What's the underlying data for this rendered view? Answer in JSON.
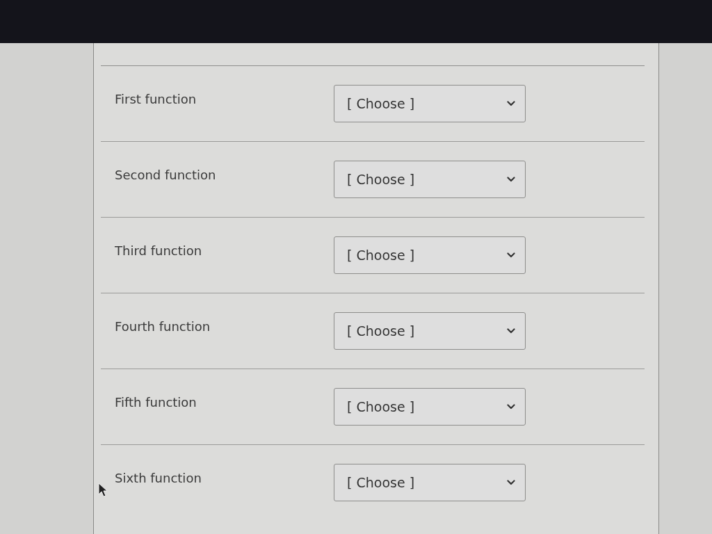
{
  "form": {
    "rows": [
      {
        "label": "First function",
        "select": {
          "value": "[ Choose ]"
        }
      },
      {
        "label": "Second function",
        "select": {
          "value": "[ Choose ]"
        }
      },
      {
        "label": "Third function",
        "select": {
          "value": "[ Choose ]"
        }
      },
      {
        "label": "Fourth function",
        "select": {
          "value": "[ Choose ]"
        }
      },
      {
        "label": "Fifth function",
        "select": {
          "value": "[ Choose ]"
        }
      },
      {
        "label": "Sixth function",
        "select": {
          "value": "[ Choose ]"
        }
      }
    ]
  }
}
